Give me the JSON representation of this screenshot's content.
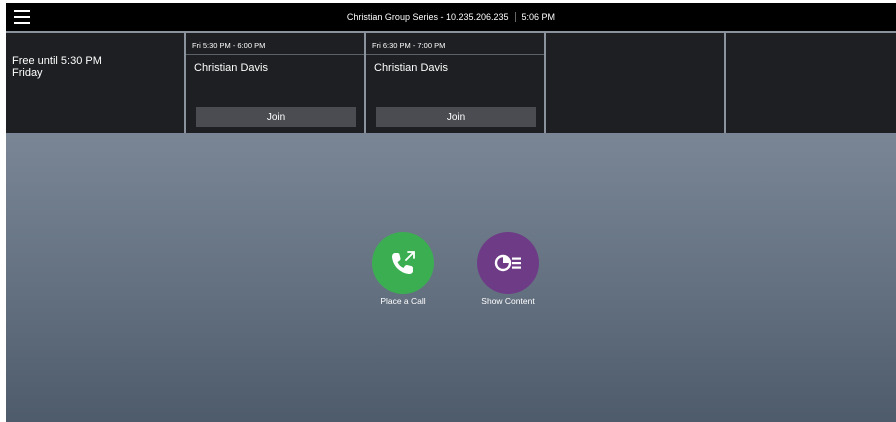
{
  "header": {
    "system_title": "Christian Group Series - 10.235.206.235",
    "time": "5:06 PM"
  },
  "status": {
    "line1": "Free until 5:30 PM",
    "line2": "Friday"
  },
  "meetings": [
    {
      "time": "Fri  5:30 PM - 6:00 PM",
      "organizer": "Christian Davis",
      "join_label": "Join"
    },
    {
      "time": "Fri  6:30 PM - 7:00 PM",
      "organizer": "Christian Davis",
      "join_label": "Join"
    }
  ],
  "actions": {
    "call_label": "Place a Call",
    "content_label": "Show Content"
  },
  "colors": {
    "call_accent": "#3cae52",
    "content_accent": "#6e3b86",
    "topbar": "#000000",
    "calendar_bg": "#1e1f22"
  }
}
